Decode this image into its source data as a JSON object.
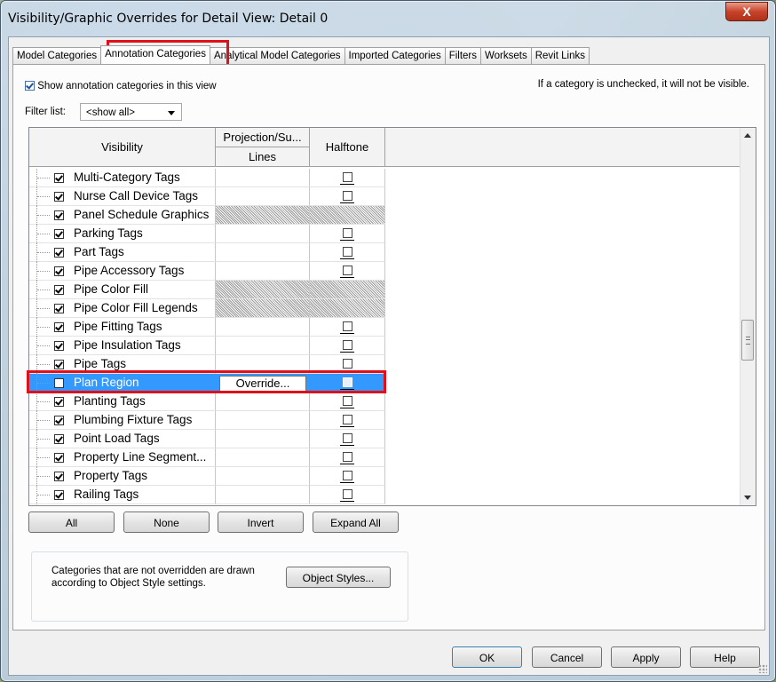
{
  "window": {
    "title": "Visibility/Graphic Overrides for Detail View: Detail 0",
    "close_label": "X"
  },
  "tabs": [
    {
      "label": "Model Categories",
      "active": false
    },
    {
      "label": "Annotation Categories",
      "active": true
    },
    {
      "label": "Analytical Model Categories",
      "active": false
    },
    {
      "label": "Imported Categories",
      "active": false
    },
    {
      "label": "Filters",
      "active": false
    },
    {
      "label": "Worksets",
      "active": false
    },
    {
      "label": "Revit Links",
      "active": false
    }
  ],
  "show_checkbox": {
    "label": "Show annotation categories in this view",
    "checked": true
  },
  "hint": "If a category is unchecked, it will not be visible.",
  "filter": {
    "label": "Filter list:",
    "value": "<show all>"
  },
  "table": {
    "headers": {
      "visibility": "Visibility",
      "projection": "Projection/Su...",
      "lines": "Lines",
      "halftone": "Halftone"
    },
    "rows": [
      {
        "name": "Multi-Category Tags",
        "visible": true,
        "hatched": false,
        "selected": false
      },
      {
        "name": "Nurse Call Device Tags",
        "visible": true,
        "hatched": false,
        "selected": false
      },
      {
        "name": "Panel Schedule Graphics",
        "visible": true,
        "hatched": true,
        "selected": false
      },
      {
        "name": "Parking Tags",
        "visible": true,
        "hatched": false,
        "selected": false
      },
      {
        "name": "Part Tags",
        "visible": true,
        "hatched": false,
        "selected": false
      },
      {
        "name": "Pipe Accessory Tags",
        "visible": true,
        "hatched": false,
        "selected": false
      },
      {
        "name": "Pipe Color Fill",
        "visible": true,
        "hatched": true,
        "selected": false
      },
      {
        "name": "Pipe Color Fill Legends",
        "visible": true,
        "hatched": true,
        "selected": false
      },
      {
        "name": "Pipe Fitting Tags",
        "visible": true,
        "hatched": false,
        "selected": false
      },
      {
        "name": "Pipe Insulation Tags",
        "visible": true,
        "hatched": false,
        "selected": false
      },
      {
        "name": "Pipe Tags",
        "visible": true,
        "hatched": false,
        "selected": false
      },
      {
        "name": "Plan Region",
        "visible": false,
        "hatched": false,
        "selected": true,
        "override_label": "Override..."
      },
      {
        "name": "Planting Tags",
        "visible": true,
        "hatched": false,
        "selected": false
      },
      {
        "name": "Plumbing Fixture Tags",
        "visible": true,
        "hatched": false,
        "selected": false
      },
      {
        "name": "Point Load Tags",
        "visible": true,
        "hatched": false,
        "selected": false
      },
      {
        "name": "Property Line Segment...",
        "visible": true,
        "hatched": false,
        "selected": false
      },
      {
        "name": "Property Tags",
        "visible": true,
        "hatched": false,
        "selected": false
      },
      {
        "name": "Railing Tags",
        "visible": true,
        "hatched": false,
        "selected": false
      }
    ]
  },
  "list_buttons": {
    "all": "All",
    "none": "None",
    "invert": "Invert",
    "expand_all": "Expand All"
  },
  "styles_note": "Categories that are not overridden are drawn according to Object Style settings.",
  "object_styles_label": "Object Styles...",
  "footer": {
    "ok": "OK",
    "cancel": "Cancel",
    "apply": "Apply",
    "help": "Help"
  },
  "colors": {
    "highlight": "#e0101a",
    "selection": "#3399ff"
  }
}
